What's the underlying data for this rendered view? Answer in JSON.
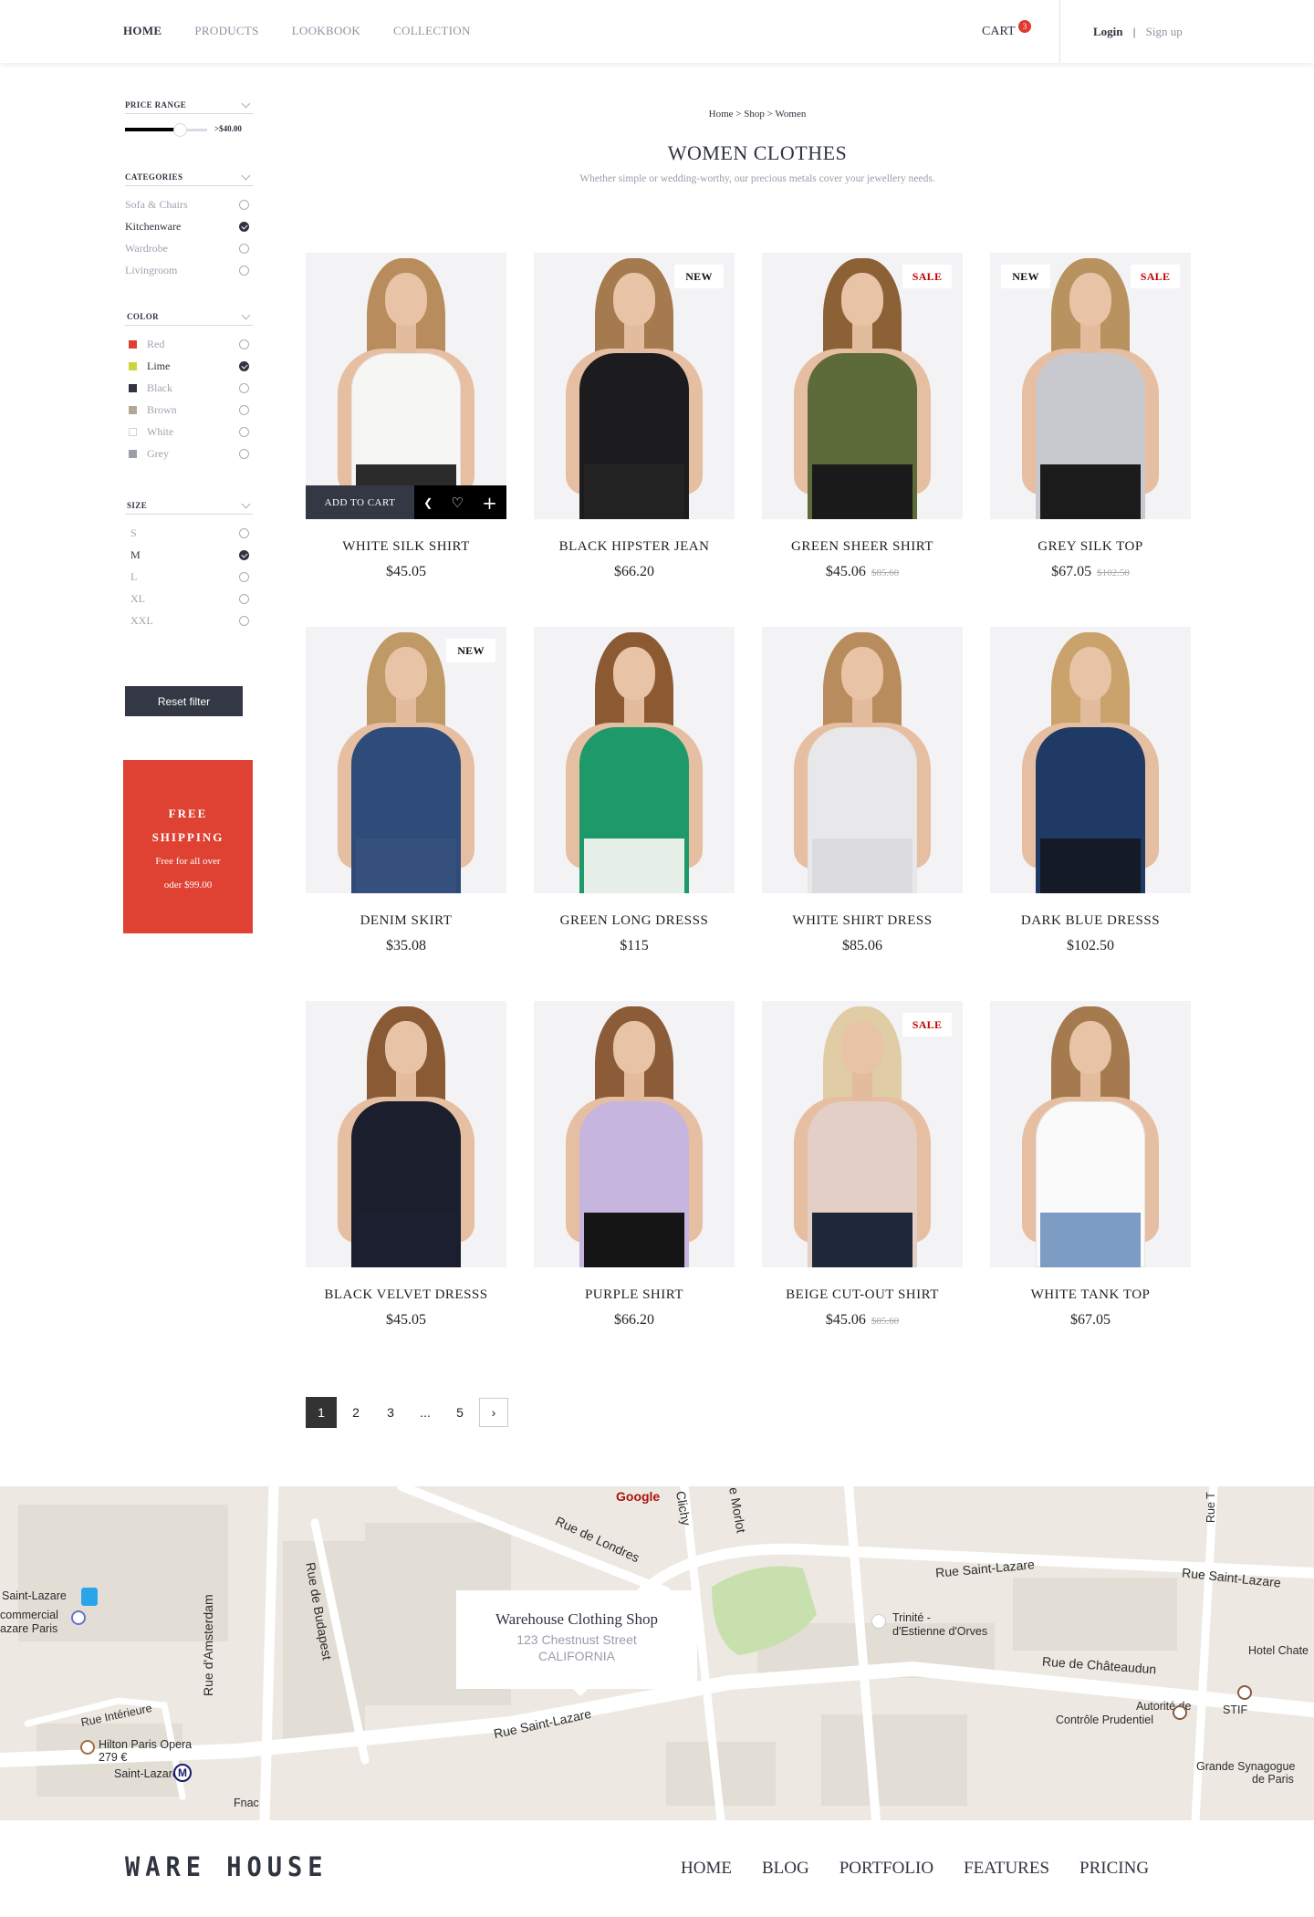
{
  "header": {
    "nav": [
      "HOME",
      "PRODUCTS",
      "LOOKBOOK",
      "COLLECTION"
    ],
    "active_nav": "HOME",
    "cart_label": "CART",
    "cart_count": "3",
    "login": "Login",
    "separator": "|",
    "signup": "Sign up"
  },
  "sidebar": {
    "price_range": {
      "title": "PRICE RANGE",
      "value_label": ">$40.00",
      "fraction": 0.62
    },
    "categories": {
      "title": "CATEGORIES",
      "items": [
        {
          "label": "Sofa & Chairs",
          "checked": false
        },
        {
          "label": "Kitchenware",
          "checked": true
        },
        {
          "label": "Wardrobe",
          "checked": false
        },
        {
          "label": "Livingroom",
          "checked": false
        }
      ]
    },
    "color": {
      "title": "COLOR",
      "items": [
        {
          "label": "Red",
          "swatch": "#e04034",
          "checked": false
        },
        {
          "label": "Lime",
          "swatch": "#ccd63a",
          "checked": true
        },
        {
          "label": "Black",
          "swatch": "#30343f",
          "checked": false
        },
        {
          "label": "Brown",
          "swatch": "#b5a795",
          "checked": false
        },
        {
          "label": "White",
          "swatch": "#ffffff",
          "checked": false
        },
        {
          "label": "Grey",
          "swatch": "#9a9ea8",
          "checked": false
        }
      ]
    },
    "size": {
      "title": "SIZE",
      "items": [
        {
          "label": "S",
          "checked": false
        },
        {
          "label": "M",
          "checked": true
        },
        {
          "label": "L",
          "checked": false
        },
        {
          "label": "XL",
          "checked": false
        },
        {
          "label": "XXL",
          "checked": false
        }
      ]
    },
    "reset_label": "Reset filter",
    "promo": {
      "title1": "FREE",
      "title2": "SHIPPING",
      "line1": "Free for all over",
      "line2": "oder $99.00",
      "color": "#df4232"
    }
  },
  "main": {
    "breadcrumb": "Home > Shop > Women",
    "title": "WOMEN CLOTHES",
    "subtitle": "Whether simple or wedding-worthy, our precious metals cover your jewellery needs.",
    "add_to_cart": "ADD TO CART",
    "products": [
      {
        "name": "WHITE SILK SHIRT",
        "price": "$45.05",
        "old_price": "",
        "badges": [],
        "hovered": true,
        "top": "#f6f6f4",
        "bottom": "#2b2b2b",
        "hair": "#b88c5c"
      },
      {
        "name": "BLACK HIPSTER JEAN",
        "price": "$66.20",
        "old_price": "",
        "badges": [
          "NEW"
        ],
        "hovered": false,
        "top": "#1c1c1e",
        "bottom": "#222",
        "hair": "#a57a4e"
      },
      {
        "name": "GREEN SHEER SHIRT",
        "price": "$45.06",
        "old_price": "$85.60",
        "badges": [
          "SALE"
        ],
        "hovered": false,
        "top": "#5d6a3a",
        "bottom": "#1a1a1a",
        "hair": "#8c6136"
      },
      {
        "name": "GREY SILK TOP",
        "price": "$67.05",
        "old_price": "$102.50",
        "badges": [
          "NEW",
          "SALE"
        ],
        "hovered": false,
        "top": "#c8c9cf",
        "bottom": "#1b1b1b",
        "hair": "#b8925f"
      },
      {
        "name": "DENIM SKIRT",
        "price": "$35.08",
        "old_price": "",
        "badges": [
          "NEW"
        ],
        "hovered": false,
        "top": "#2f4b7a",
        "bottom": "#36507e",
        "hair": "#bf9a66"
      },
      {
        "name": "GREEN LONG DRESSS",
        "price": "$115",
        "old_price": "",
        "badges": [],
        "hovered": false,
        "top": "#1e9a6a",
        "bottom": "#e7efe9",
        "hair": "#8b5a32"
      },
      {
        "name": "WHITE SHIRT DRESS",
        "price": "$85.06",
        "old_price": "",
        "badges": [],
        "hovered": false,
        "top": "#e8e8ea",
        "bottom": "#dcdcde",
        "hair": "#b88c5c"
      },
      {
        "name": "DARK BLUE DRESSS",
        "price": "$102.50",
        "old_price": "",
        "badges": [],
        "hovered": false,
        "top": "#203a66",
        "bottom": "#141a26",
        "hair": "#c9a36b"
      },
      {
        "name": "BLACK VELVET DRESSS",
        "price": "$45.05",
        "old_price": "",
        "badges": [],
        "hovered": false,
        "top": "#1b1f2d",
        "bottom": "#1c2030",
        "hair": "#8a5a34"
      },
      {
        "name": "PURPLE SHIRT",
        "price": "$66.20",
        "old_price": "",
        "badges": [],
        "hovered": false,
        "top": "#c6b5de",
        "bottom": "#151515",
        "hair": "#8b5c37"
      },
      {
        "name": "BEIGE CUT-OUT SHIRT",
        "price": "$45.06",
        "old_price": "$85.60",
        "badges": [
          "SALE"
        ],
        "hovered": false,
        "top": "#e3cfc6",
        "bottom": "#1f2838",
        "hair": "#e0cda6"
      },
      {
        "name": "WHITE TANK TOP",
        "price": "$67.05",
        "old_price": "",
        "badges": [],
        "hovered": false,
        "top": "#fafafa",
        "bottom": "#7c9cc4",
        "hair": "#a57a4e"
      }
    ],
    "pagination": {
      "pages": [
        "1",
        "2",
        "3",
        "...",
        "5"
      ],
      "current": "1",
      "next": "›"
    }
  },
  "map": {
    "info": {
      "name": "Warehouse Clothing Shop",
      "address": "123 Chestnust Street",
      "region": "CALIFORNIA"
    },
    "labels": {
      "google": "Google",
      "clichy": "Clichy",
      "morlot": "e Morlot",
      "rue_de_londres": "Rue de Londres",
      "rue_saint_lazare_1": "Rue Saint-Lazare",
      "rue_saint_lazare_2": "Rue Saint-Lazare",
      "rue_saint_lazare_3": "Rue Saint-Lazare",
      "saint_lazare_station": "Saint-Lazare",
      "commercial_1": "commercial",
      "commercial_2": "azare Paris",
      "rue_amsterdam": "Rue d'Amsterdam",
      "rue_budapest": "Rue de Budapest",
      "rue_interieure": "Rue Intérieure",
      "hilton": "Hilton Paris Opera",
      "hilton_price": "279 €",
      "saint_lazare_metro": "Saint-Lazare",
      "fnac": "Fnac",
      "trinite_1": "Trinité -",
      "trinite_2": "d'Estienne d'Orves",
      "rue_chateaudun": "Rue de Châteaudun",
      "hotel": "Hotel Chate",
      "stif": "STIF",
      "autorite_1": "Autorité de",
      "autorite_2": "Contrôle Prudentiel",
      "synagogue_1": "Grande Synagogue",
      "synagogue_2": "de Paris",
      "rue_t": "Rue T"
    }
  },
  "footer": {
    "logo": "WARE HOUSE",
    "nav": [
      "HOME",
      "BLOG",
      "PORTFOLIO",
      "FEATURES",
      "PRICING"
    ]
  }
}
